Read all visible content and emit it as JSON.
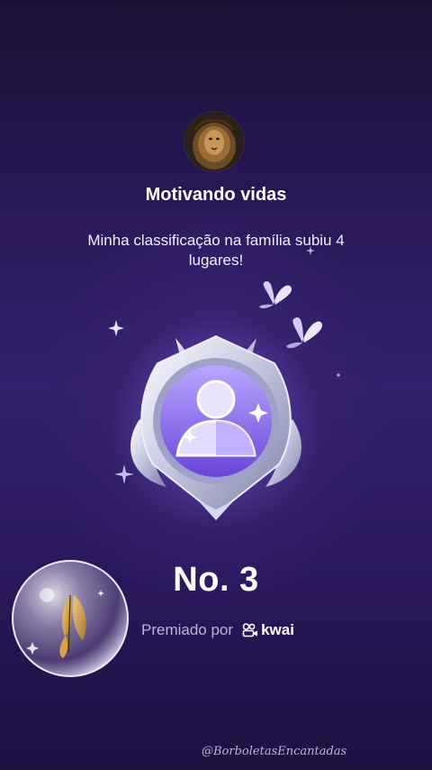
{
  "header": {
    "avatar_icon": "lion-avatar-icon",
    "title": "Motivando vidas"
  },
  "message": {
    "text": "Minha classificação na família subiu 4 lugares!"
  },
  "badge": {
    "icon": "family-rank-badge-icon"
  },
  "rank": {
    "label": "No. 3"
  },
  "award": {
    "label": "Premiado por",
    "brand": "kwai",
    "brand_icon": "kwai-logo-icon"
  },
  "overlay": {
    "bubble_icon": "butterfly-bubble-icon",
    "watermark": "@BorboletasEncantadas"
  },
  "colors": {
    "background": "#2a1858",
    "accent": "#8b6cf0",
    "text": "#ffffff",
    "muted_text": "#bcb4d6"
  }
}
